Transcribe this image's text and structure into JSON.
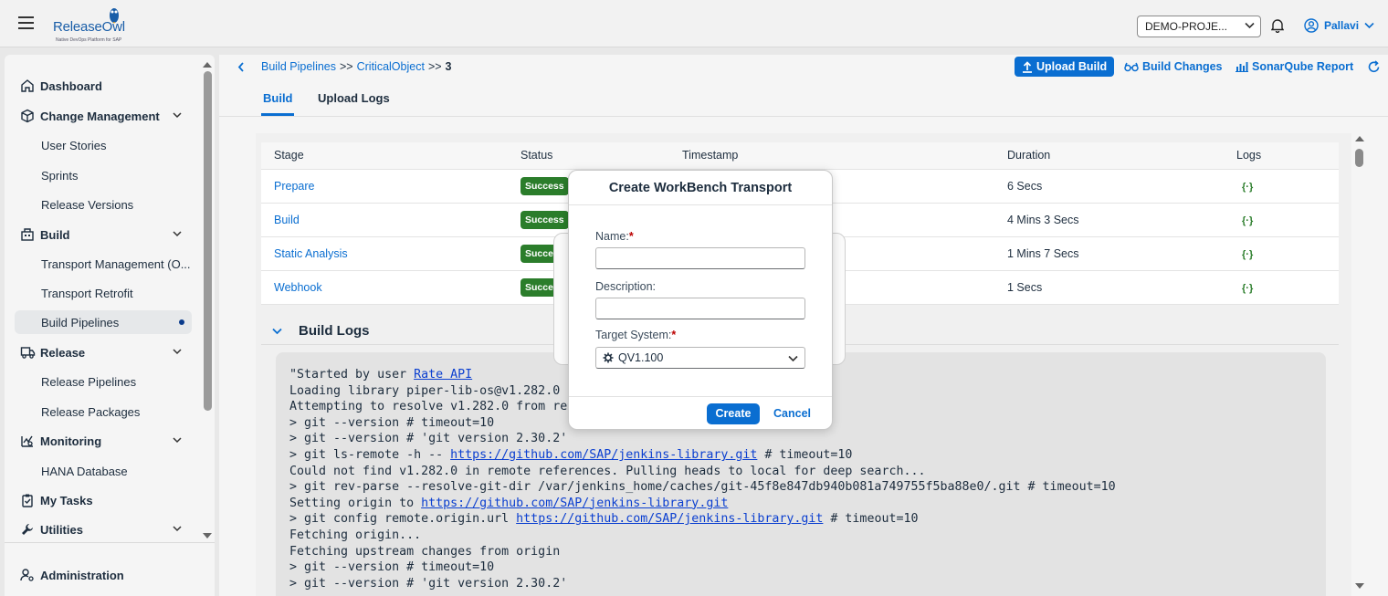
{
  "header": {
    "logo_text": "ReleaseOwl",
    "logo_tagline": "Native DevOps Platform for SAP",
    "project": "DEMO-PROJE...",
    "user": "Pallavi"
  },
  "sidebar": {
    "dashboard": "Dashboard",
    "change_management": "Change Management",
    "user_stories": "User Stories",
    "sprints": "Sprints",
    "release_versions": "Release Versions",
    "build": "Build",
    "transport_management": "Transport Management (O...",
    "transport_retrofit": "Transport Retrofit",
    "build_pipelines": "Build Pipelines",
    "release": "Release",
    "release_pipelines": "Release Pipelines",
    "release_packages": "Release Packages",
    "monitoring": "Monitoring",
    "hana_database": "HANA Database",
    "my_tasks": "My Tasks",
    "utilities": "Utilities",
    "administration": "Administration"
  },
  "breadcrumb": {
    "level1": "Build Pipelines",
    "sep1": ">>",
    "level2": "CriticalObject",
    "sep2": ">>",
    "current": "3"
  },
  "toolbar": {
    "upload_build": "Upload Build",
    "build_changes": "Build Changes",
    "sonarqube_report": "SonarQube Report"
  },
  "tabs": {
    "build": "Build",
    "upload_logs": "Upload Logs"
  },
  "stages_table": {
    "headers": [
      "Stage",
      "Status",
      "Timestamp",
      "Duration",
      "Logs"
    ],
    "rows": [
      {
        "stage": "Prepare",
        "status": "Success",
        "duration": "6 Secs",
        "logs": "{·}"
      },
      {
        "stage": "Build",
        "status": "Success",
        "duration": "4 Mins 3 Secs",
        "logs": "{·}"
      },
      {
        "stage": "Static Analysis",
        "status": "Succe",
        "duration": "1 Mins 7 Secs",
        "logs": "{·}"
      },
      {
        "stage": "Webhook",
        "status": "Succe",
        "duration": "1 Secs",
        "logs": "{·}"
      }
    ]
  },
  "build_logs": {
    "title": "Build Logs",
    "lines": [
      {
        "pre": "\"Started by user ",
        "link": "Rate API",
        "post": ""
      },
      {
        "pre": "Loading library piper-lib-os@v1.282.0",
        "link": "",
        "post": ""
      },
      {
        "pre": "Attempting to resolve v1.282.0 from rem",
        "link": "",
        "post": ""
      },
      {
        "pre": "> git --version # timeout=10",
        "link": "",
        "post": ""
      },
      {
        "pre": "> git --version # 'git version 2.30.2'",
        "link": "",
        "post": ""
      },
      {
        "pre": "> git ls-remote -h -- ",
        "link": "https://github.com/SAP/jenkins-library.git",
        "post": " # timeout=10"
      },
      {
        "pre": "Could not find v1.282.0 in remote references. Pulling heads to local for deep search...",
        "link": "",
        "post": ""
      },
      {
        "pre": "> git rev-parse --resolve-git-dir /var/jenkins_home/caches/git-45f8e847db940b081a749755f5ba88e0/.git # timeout=10",
        "link": "",
        "post": ""
      },
      {
        "pre": "Setting origin to ",
        "link": "https://github.com/SAP/jenkins-library.git",
        "post": ""
      },
      {
        "pre": "> git config remote.origin.url ",
        "link": "https://github.com/SAP/jenkins-library.git",
        "post": " # timeout=10"
      },
      {
        "pre": "Fetching origin...",
        "link": "",
        "post": ""
      },
      {
        "pre": "Fetching upstream changes from origin",
        "link": "",
        "post": ""
      },
      {
        "pre": "> git --version # timeout=10",
        "link": "",
        "post": ""
      },
      {
        "pre": "> git --version # 'git version 2.30.2'",
        "link": "",
        "post": ""
      }
    ]
  },
  "modal": {
    "title": "Create WorkBench Transport",
    "name_label": "Name:",
    "name_value": "",
    "description_label": "Description:",
    "description_value": "",
    "target_system_label": "Target System:",
    "target_system_value": "QV1.100",
    "required_mark": "*",
    "create_label": "Create",
    "cancel_label": "Cancel"
  },
  "colors": {
    "accent": "#0a6ed1",
    "success": "#2b7d2b",
    "required": "#bb0000"
  }
}
